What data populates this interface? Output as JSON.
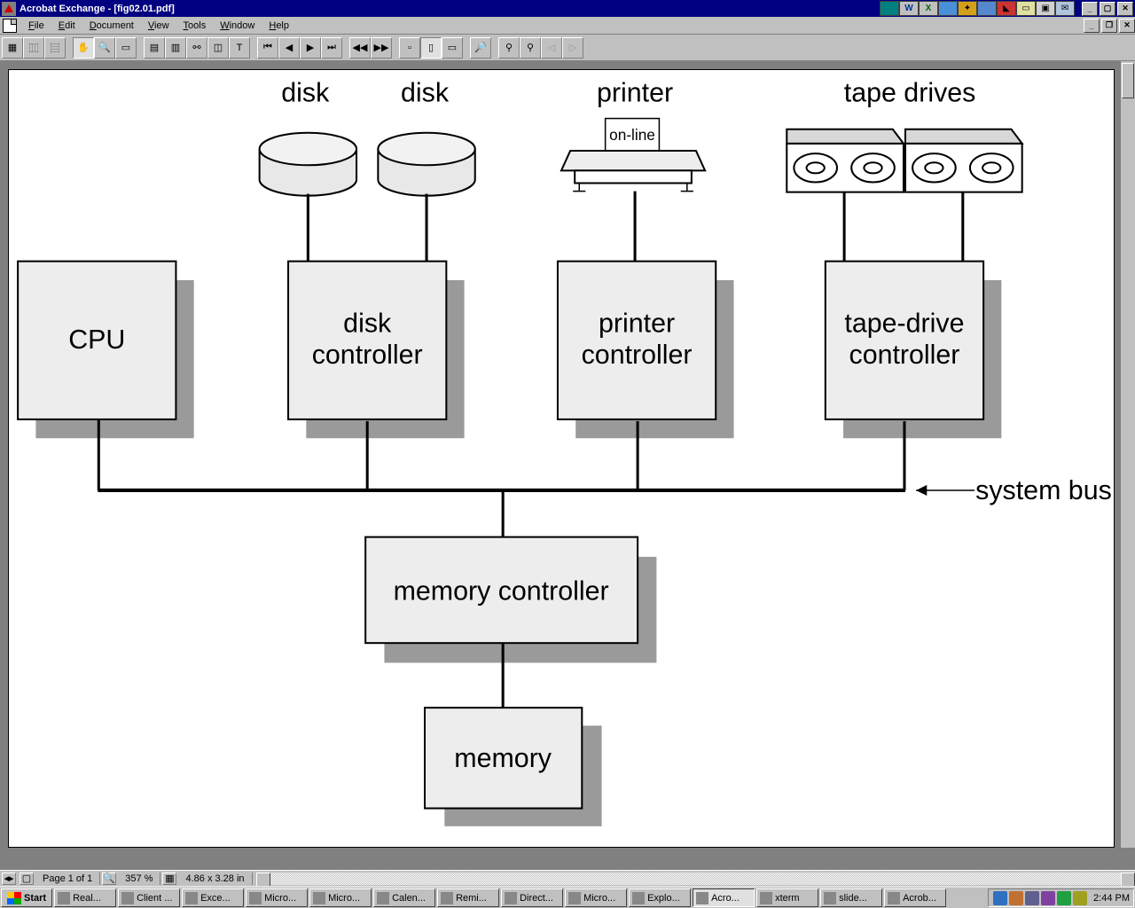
{
  "app": {
    "title": "Acrobat Exchange - [fig02.01.pdf]"
  },
  "menu": {
    "items": [
      "File",
      "Edit",
      "Document",
      "View",
      "Tools",
      "Window",
      "Help"
    ]
  },
  "status": {
    "page": "Page 1 of 1",
    "zoom": "357 %",
    "size": "4.86 x 3.28 in"
  },
  "diagram": {
    "devices": {
      "disk1_label": "disk",
      "disk2_label": "disk",
      "printer_label": "printer",
      "printer_state": "on-line",
      "tape_label": "tape drives"
    },
    "boxes": {
      "cpu": "CPU",
      "disk_ctrl_l1": "disk",
      "disk_ctrl_l2": "controller",
      "printer_ctrl_l1": "printer",
      "printer_ctrl_l2": "controller",
      "tape_ctrl_l1": "tape-drive",
      "tape_ctrl_l2": "controller",
      "mem_ctrl": "memory controller",
      "memory": "memory"
    },
    "bus_label": "system bus"
  },
  "taskbar": {
    "start": "Start",
    "items": [
      "Real...",
      "Client ...",
      "Exce...",
      "Micro...",
      "Micro...",
      "Calen...",
      "Remi...",
      "Direct...",
      "Micro...",
      "Explo...",
      "Acro...",
      "xterm",
      "slide...",
      "Acrob..."
    ],
    "active_index": 10,
    "clock": "2:44 PM"
  }
}
